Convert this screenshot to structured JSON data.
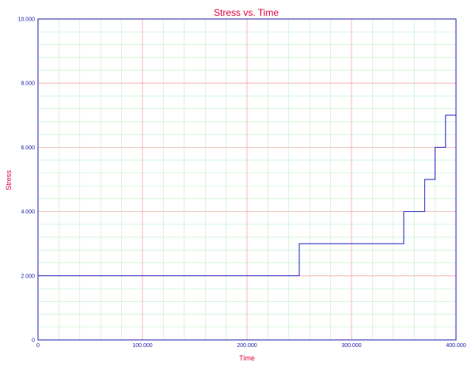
{
  "colors": {
    "title": "#e0003c",
    "axis_label": "#e0003c",
    "tick_label": "#1a1aa6",
    "frame": "#1a1aa6",
    "major_grid": "#f4a6a6",
    "minor_grid": "#b8f0c4",
    "series_line": "#2020c8",
    "background": "#ffffff"
  },
  "chart_data": {
    "type": "line",
    "step": true,
    "title": "Stress vs. Time",
    "xlabel": "Time",
    "ylabel": "Stress",
    "xlim": [
      0,
      400000
    ],
    "ylim": [
      0,
      10
    ],
    "xticks": [
      0,
      100000,
      200000,
      300000,
      400000
    ],
    "xtick_labels": [
      "0",
      "100.000",
      "200.000",
      "300.000",
      "400.000"
    ],
    "yticks": [
      0,
      2,
      4,
      6,
      8,
      10
    ],
    "ytick_labels": [
      "0",
      "2.000",
      "4.000",
      "6.000",
      "8.000",
      "10.000"
    ],
    "grid": true,
    "minor_grid": true,
    "legend": false,
    "series": [
      {
        "x": [
          0,
          250000,
          250000,
          350000,
          350000,
          370000,
          370000,
          380000,
          380000,
          390000,
          390000,
          400000
        ],
        "y": [
          2,
          2,
          3,
          3,
          4,
          4,
          5,
          5,
          6,
          6,
          7,
          7
        ]
      }
    ]
  }
}
